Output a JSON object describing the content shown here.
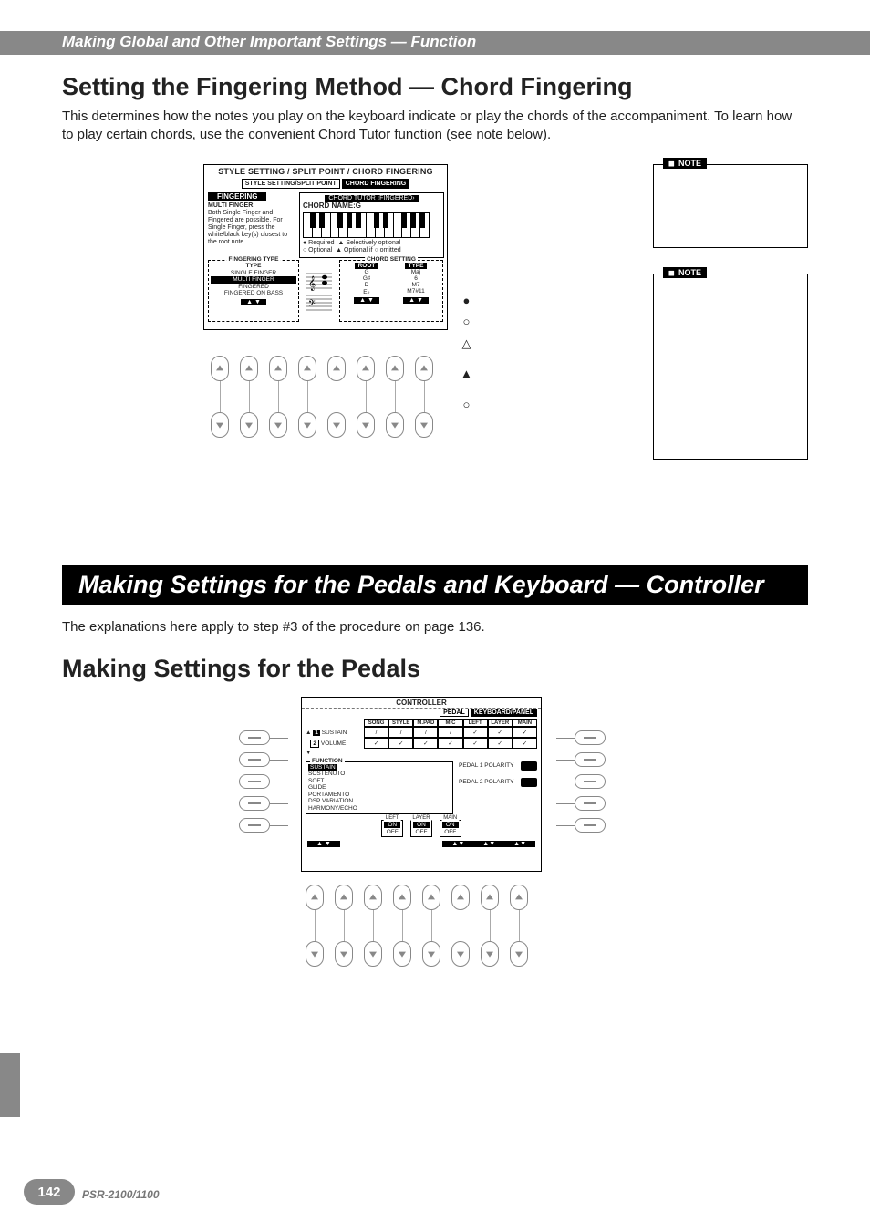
{
  "header": {
    "breadcrumb": "Making Global and Other Important Settings — Function"
  },
  "section1": {
    "title": "Setting the Fingering Method — Chord Fingering",
    "intro": "This determines how the notes you play on the keyboard indicate or play the chords of the accompaniment. To learn how to play certain chords, use the convenient Chord Tutor function (see note below)."
  },
  "lcd1": {
    "title": "STYLE SETTING / SPLIT POINT / CHORD FINGERING",
    "tabs": [
      "STYLE SETTING/SPLIT POINT",
      "CHORD FINGERING"
    ],
    "fingering_label": "FINGERING",
    "fingering_name": "MULTI FINGER:",
    "fingering_desc": "Both Single Finger and Fingered are possible. For Single Finger, press the white/black key(s) closest to the root note.",
    "chord_tutor_label": "CHORD TUTOR ‹FINGERED›",
    "chord_name_label": "CHORD NAME:G",
    "legend": {
      "required": "● Required",
      "selopt": "▲ Selectively optional",
      "optional": "○ Optional",
      "optomit": "▲ Optional if ○ omitted"
    },
    "fingering_type_box": {
      "caption": "FINGERING TYPE",
      "subcaption": "TYPE",
      "items": [
        "SINGLE FINGER",
        "MULTI FINGER",
        "FINGERED",
        "FINGERED ON BASS"
      ],
      "selected_index": 1
    },
    "chord_setting_box": {
      "caption": "CHORD SETTING",
      "root_label": "ROOT",
      "type_label": "TYPE",
      "rows": [
        {
          "root": "G",
          "type": "Maj"
        },
        {
          "root": "G♯",
          "type": "6"
        },
        {
          "root": "D",
          "type": "M7"
        },
        {
          "root": "E♭",
          "type": "M7#11"
        }
      ]
    },
    "symbol_col": [
      "●",
      "○",
      "△",
      "",
      "▲",
      "",
      "○"
    ]
  },
  "notes": {
    "label": "NOTE"
  },
  "section2": {
    "black_bar": "Making Settings for the Pedals and Keyboard — Controller",
    "intro": "The explanations here apply to step #3 of the procedure on page 136.",
    "title": "Making Settings for the Pedals"
  },
  "lcd2": {
    "title": "CONTROLLER",
    "tabs": [
      "PEDAL",
      "KEYBOARD/PANEL"
    ],
    "cols": [
      "SONG",
      "STYLE",
      "M.PAD",
      "MIC",
      "LEFT",
      "LAYER",
      "MAIN"
    ],
    "rows": [
      {
        "num": "1",
        "name": "SUSTAIN",
        "cells": [
          "/",
          "/",
          "/",
          "/",
          "✓",
          "✓",
          "✓"
        ]
      },
      {
        "num": "2",
        "name": "VOLUME",
        "cells": [
          "✓",
          "✓",
          "✓",
          "✓",
          "✓",
          "✓",
          "✓"
        ]
      }
    ],
    "function_box": {
      "caption": "FUNCTION",
      "items": [
        "SUSTAIN",
        "SOSTENUTO",
        "SOFT",
        "GLIDE",
        "PORTAMENTO",
        "DSP VARIATION",
        "HARMONY/ECHO"
      ],
      "selected_index": 0
    },
    "polarity": {
      "p1": "PEDAL 1 POLARITY",
      "p2": "PEDAL 2 POLARITY"
    },
    "onoff": [
      {
        "cap": "LEFT",
        "on": "ON",
        "off": "OFF"
      },
      {
        "cap": "LAYER",
        "on": "ON",
        "off": "OFF"
      },
      {
        "cap": "MAIN",
        "on": "ON",
        "off": "OFF"
      }
    ]
  },
  "footer": {
    "page": "142",
    "model": "PSR-2100/1100"
  }
}
